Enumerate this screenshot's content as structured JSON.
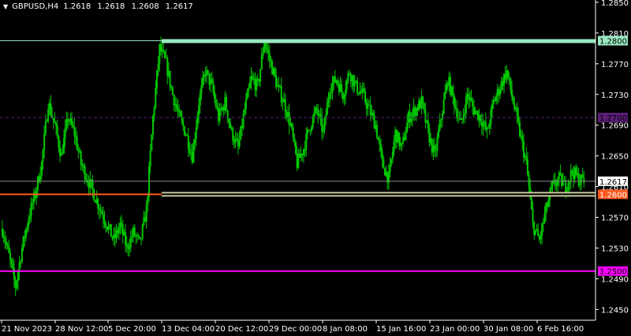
{
  "window": {
    "title_symbol": "GBPUSD,H4",
    "ohlc": [
      "1.2618",
      "1.2618",
      "1.2608",
      "1.2617"
    ]
  },
  "colors": {
    "background": "#000000",
    "axis": "#ffffff",
    "candles": "#00c800",
    "level_1_2800": "#98e8c0",
    "level_1_2600": "#ff5a1e",
    "level_1_2500": "#ff00ff",
    "level_1_2700_dashed": "#5a1e78",
    "current_price_line": "#888888"
  },
  "chart_data": {
    "type": "line",
    "symbol": "GBPUSD",
    "timeframe": "H4",
    "ylim": [
      1.2436,
      1.2853
    ],
    "y_ticks": [
      "1.2850",
      "1.2810",
      "1.2770",
      "1.2730",
      "1.2690",
      "1.2650",
      "1.2610",
      "1.2570",
      "1.2530",
      "1.2490",
      "1.2450"
    ],
    "x_tick_labels": [
      "21 Nov 2023",
      "28 Nov 12:00",
      "5 Dec 20:00",
      "13 Dec 04:00",
      "20 Dec 12:00",
      "29 Dec 00:00",
      "8 Jan 08:00",
      "15 Jan 16:00",
      "23 Jan 00:00",
      "30 Jan 08:00",
      "6 Feb 16:00"
    ],
    "current_price": "1.2617",
    "levels": [
      {
        "price": "1.2800",
        "color": "#98e8c0"
      },
      {
        "price": "1.2700",
        "color": "#5a1e78"
      },
      {
        "price": "1.2600",
        "color": "#ff5a1e"
      },
      {
        "price": "1.2500",
        "color": "#ff00ff"
      }
    ],
    "closes": [
      1.2555,
      1.252,
      1.248,
      1.253,
      1.257,
      1.26,
      1.264,
      1.272,
      1.269,
      1.265,
      1.27,
      1.268,
      1.264,
      1.262,
      1.26,
      1.258,
      1.256,
      1.254,
      1.256,
      1.253,
      1.255,
      1.2535,
      1.258,
      1.27,
      1.279,
      1.277,
      1.273,
      1.27,
      1.268,
      1.265,
      1.272,
      1.276,
      1.274,
      1.27,
      1.272,
      1.268,
      1.266,
      1.271,
      1.275,
      1.274,
      1.28,
      1.277,
      1.274,
      1.272,
      1.269,
      1.264,
      1.266,
      1.269,
      1.271,
      1.268,
      1.274,
      1.275,
      1.273,
      1.276,
      1.274,
      1.273,
      1.271,
      1.269,
      1.264,
      1.262,
      1.268,
      1.266,
      1.27,
      1.271,
      1.272,
      1.268,
      1.265,
      1.27,
      1.275,
      1.272,
      1.269,
      1.273,
      1.271,
      1.27,
      1.268,
      1.272,
      1.274,
      1.276,
      1.272,
      1.268,
      1.264,
      1.256,
      1.254,
      1.258,
      1.261,
      1.262,
      1.261,
      1.263,
      1.262,
      1.2617
    ]
  }
}
